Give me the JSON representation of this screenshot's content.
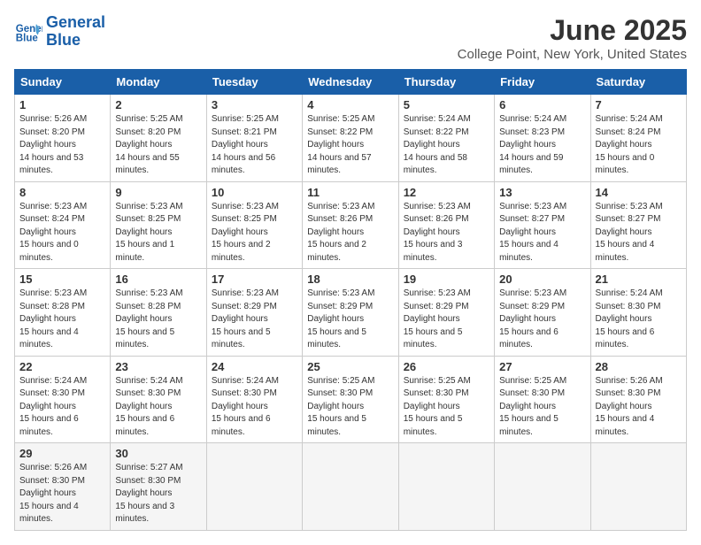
{
  "header": {
    "logo_line1": "General",
    "logo_line2": "Blue",
    "month_title": "June 2025",
    "location": "College Point, New York, United States"
  },
  "columns": [
    "Sunday",
    "Monday",
    "Tuesday",
    "Wednesday",
    "Thursday",
    "Friday",
    "Saturday"
  ],
  "weeks": [
    [
      {
        "day": "1",
        "sunrise": "5:26 AM",
        "sunset": "8:20 PM",
        "daylight": "14 hours and 53 minutes."
      },
      {
        "day": "2",
        "sunrise": "5:25 AM",
        "sunset": "8:20 PM",
        "daylight": "14 hours and 55 minutes."
      },
      {
        "day": "3",
        "sunrise": "5:25 AM",
        "sunset": "8:21 PM",
        "daylight": "14 hours and 56 minutes."
      },
      {
        "day": "4",
        "sunrise": "5:25 AM",
        "sunset": "8:22 PM",
        "daylight": "14 hours and 57 minutes."
      },
      {
        "day": "5",
        "sunrise": "5:24 AM",
        "sunset": "8:22 PM",
        "daylight": "14 hours and 58 minutes."
      },
      {
        "day": "6",
        "sunrise": "5:24 AM",
        "sunset": "8:23 PM",
        "daylight": "14 hours and 59 minutes."
      },
      {
        "day": "7",
        "sunrise": "5:24 AM",
        "sunset": "8:24 PM",
        "daylight": "15 hours and 0 minutes."
      }
    ],
    [
      {
        "day": "8",
        "sunrise": "5:23 AM",
        "sunset": "8:24 PM",
        "daylight": "15 hours and 0 minutes."
      },
      {
        "day": "9",
        "sunrise": "5:23 AM",
        "sunset": "8:25 PM",
        "daylight": "15 hours and 1 minute."
      },
      {
        "day": "10",
        "sunrise": "5:23 AM",
        "sunset": "8:25 PM",
        "daylight": "15 hours and 2 minutes."
      },
      {
        "day": "11",
        "sunrise": "5:23 AM",
        "sunset": "8:26 PM",
        "daylight": "15 hours and 2 minutes."
      },
      {
        "day": "12",
        "sunrise": "5:23 AM",
        "sunset": "8:26 PM",
        "daylight": "15 hours and 3 minutes."
      },
      {
        "day": "13",
        "sunrise": "5:23 AM",
        "sunset": "8:27 PM",
        "daylight": "15 hours and 4 minutes."
      },
      {
        "day": "14",
        "sunrise": "5:23 AM",
        "sunset": "8:27 PM",
        "daylight": "15 hours and 4 minutes."
      }
    ],
    [
      {
        "day": "15",
        "sunrise": "5:23 AM",
        "sunset": "8:28 PM",
        "daylight": "15 hours and 4 minutes."
      },
      {
        "day": "16",
        "sunrise": "5:23 AM",
        "sunset": "8:28 PM",
        "daylight": "15 hours and 5 minutes."
      },
      {
        "day": "17",
        "sunrise": "5:23 AM",
        "sunset": "8:29 PM",
        "daylight": "15 hours and 5 minutes."
      },
      {
        "day": "18",
        "sunrise": "5:23 AM",
        "sunset": "8:29 PM",
        "daylight": "15 hours and 5 minutes."
      },
      {
        "day": "19",
        "sunrise": "5:23 AM",
        "sunset": "8:29 PM",
        "daylight": "15 hours and 5 minutes."
      },
      {
        "day": "20",
        "sunrise": "5:23 AM",
        "sunset": "8:29 PM",
        "daylight": "15 hours and 6 minutes."
      },
      {
        "day": "21",
        "sunrise": "5:24 AM",
        "sunset": "8:30 PM",
        "daylight": "15 hours and 6 minutes."
      }
    ],
    [
      {
        "day": "22",
        "sunrise": "5:24 AM",
        "sunset": "8:30 PM",
        "daylight": "15 hours and 6 minutes."
      },
      {
        "day": "23",
        "sunrise": "5:24 AM",
        "sunset": "8:30 PM",
        "daylight": "15 hours and 6 minutes."
      },
      {
        "day": "24",
        "sunrise": "5:24 AM",
        "sunset": "8:30 PM",
        "daylight": "15 hours and 6 minutes."
      },
      {
        "day": "25",
        "sunrise": "5:25 AM",
        "sunset": "8:30 PM",
        "daylight": "15 hours and 5 minutes."
      },
      {
        "day": "26",
        "sunrise": "5:25 AM",
        "sunset": "8:30 PM",
        "daylight": "15 hours and 5 minutes."
      },
      {
        "day": "27",
        "sunrise": "5:25 AM",
        "sunset": "8:30 PM",
        "daylight": "15 hours and 5 minutes."
      },
      {
        "day": "28",
        "sunrise": "5:26 AM",
        "sunset": "8:30 PM",
        "daylight": "15 hours and 4 minutes."
      }
    ],
    [
      {
        "day": "29",
        "sunrise": "5:26 AM",
        "sunset": "8:30 PM",
        "daylight": "15 hours and 4 minutes."
      },
      {
        "day": "30",
        "sunrise": "5:27 AM",
        "sunset": "8:30 PM",
        "daylight": "15 hours and 3 minutes."
      },
      null,
      null,
      null,
      null,
      null
    ]
  ]
}
